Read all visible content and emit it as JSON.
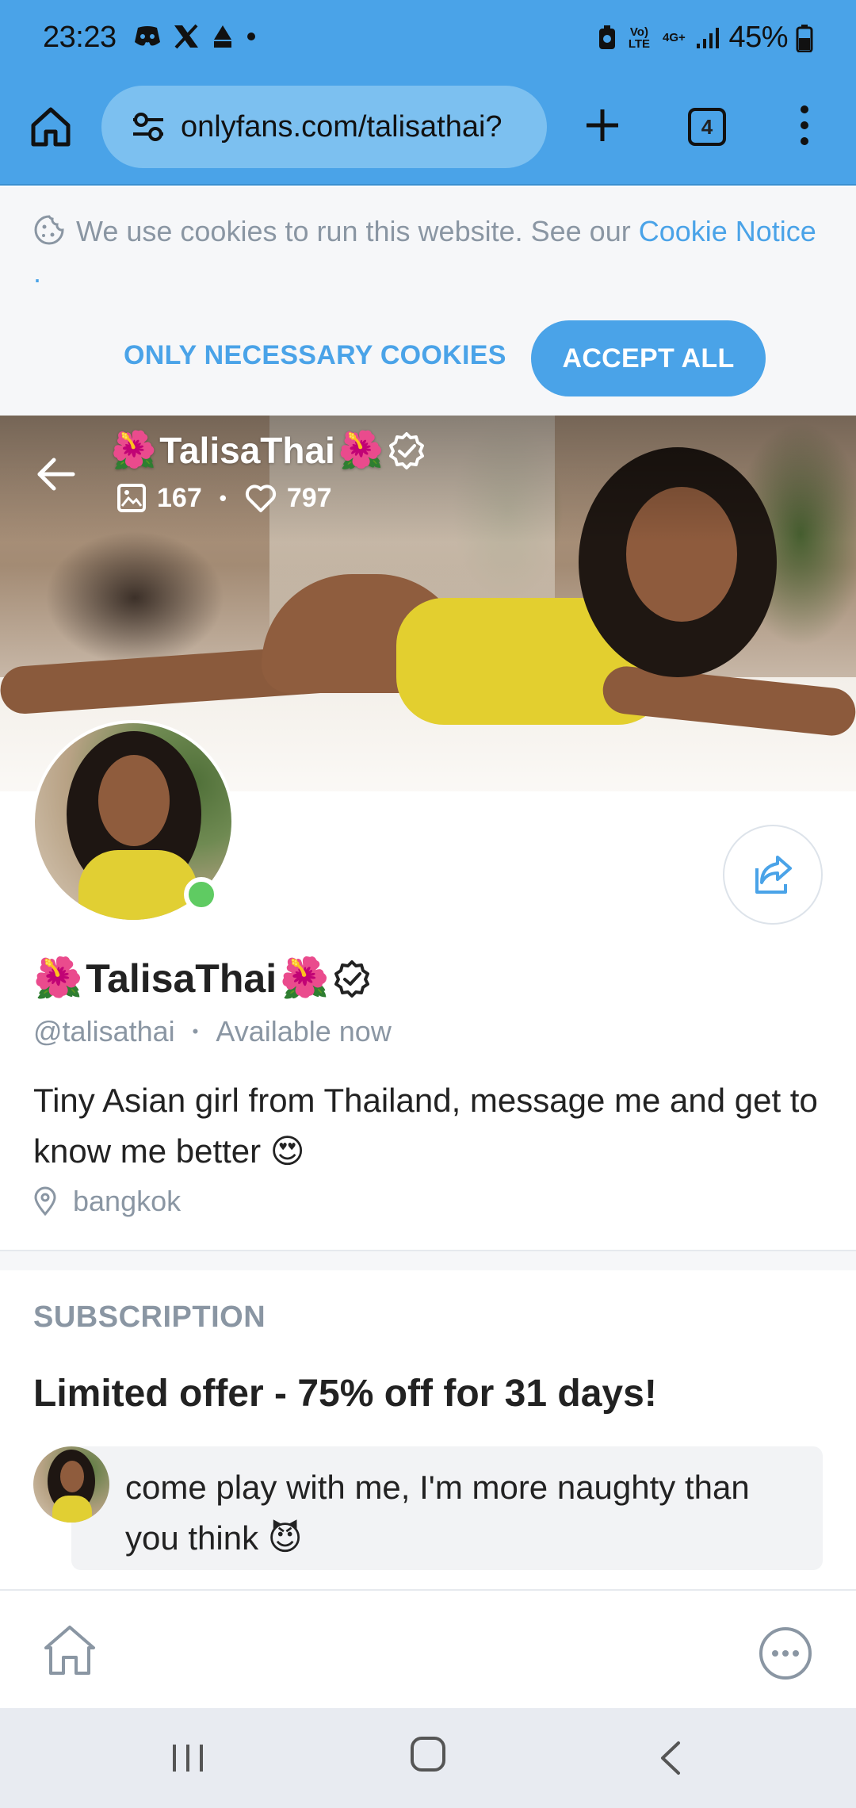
{
  "status_bar": {
    "time": "23:23",
    "battery_percent": "45%",
    "network_label_top": "Vo) LTE",
    "network_label_4g": "4G+",
    "left_icons": [
      "discord-icon",
      "x-icon",
      "app-icon",
      "dot-icon"
    ],
    "right_icons": [
      "nfc-icon",
      "signal-icon",
      "battery-icon"
    ]
  },
  "browser": {
    "url": "onlyfans.com/talisathai?",
    "tab_count": "4"
  },
  "cookie_banner": {
    "text": "We use cookies to run this website. See our ",
    "link_text": "Cookie Notice",
    "text_end": " .",
    "necessary_label": "ONLY NECESSARY COOKIES",
    "accept_label": "ACCEPT ALL"
  },
  "cover": {
    "name": "TalisaThai",
    "name_emoji": "🌺",
    "media_count": "167",
    "likes_count": "797"
  },
  "profile": {
    "display_name": "TalisaThai",
    "name_emoji": "🌺",
    "handle": "@talisathai",
    "status": "Available now",
    "bio": "Tiny Asian girl from Thailand, message me and get to know me better 😍",
    "location": "bangkok"
  },
  "subscription": {
    "section_label": "SUBSCRIPTION",
    "offer_title": "Limited offer - 75% off for 31 days!",
    "message": "come play with me, I'm more naughty than you think 😈"
  },
  "colors": {
    "accent": "#4aa3e8",
    "muted_text": "#8a96a3",
    "online": "#5fcb62"
  }
}
